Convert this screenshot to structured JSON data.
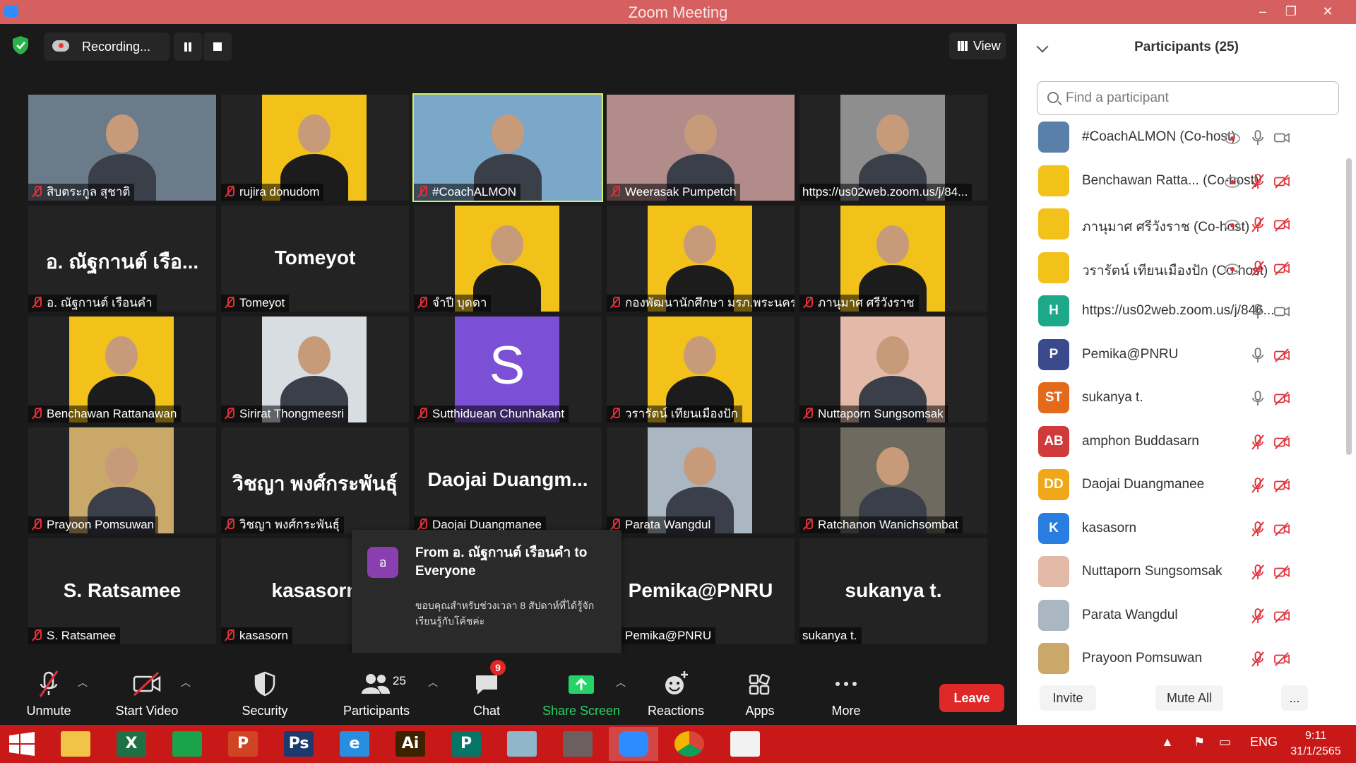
{
  "window": {
    "title": "Zoom Meeting"
  },
  "recording": {
    "label": "Recording..."
  },
  "view_btn": "View",
  "tiles": [
    {
      "name": "สิบตระกูล สุชาติ",
      "big": "",
      "kind": "photo",
      "bg": "#6b7b8a"
    },
    {
      "name": "rujira donudom",
      "big": "",
      "kind": "poster",
      "bg": "#f2c21a"
    },
    {
      "name": "#CoachALMON",
      "big": "",
      "kind": "photo",
      "bg": "#7ba7c9",
      "active": true
    },
    {
      "name": "Weerasak Pumpetch",
      "big": "",
      "kind": "photo",
      "bg": "#b28b8b"
    },
    {
      "name": "https://us02web.zoom.us/j/84...",
      "big": "",
      "kind": "photo",
      "bg": "#8e8e8e",
      "nomute": true
    },
    {
      "name": "อ. ณัฐกานต์ เรือนคำ",
      "big": "อ. ณัฐกานต์  เรือ...",
      "kind": "name"
    },
    {
      "name": "Tomeyot",
      "big": "Tomeyot",
      "kind": "name"
    },
    {
      "name": "จำปี บุดดา",
      "big": "",
      "kind": "poster",
      "bg": "#f2c21a"
    },
    {
      "name": "กองพัฒนานักศึกษา มรภ.พระนคร",
      "big": "",
      "kind": "poster",
      "bg": "#f2c21a"
    },
    {
      "name": "ภานุมาศ ศรีวังราช",
      "big": "",
      "kind": "poster",
      "bg": "#f2c21a"
    },
    {
      "name": "Benchawan Rattanawan",
      "big": "",
      "kind": "poster",
      "bg": "#f2c21a"
    },
    {
      "name": "Sirirat Thongmeesri",
      "big": "",
      "kind": "photo",
      "bg": "#d8dde2"
    },
    {
      "name": "Sutthiduean Chunhakant",
      "big": "",
      "kind": "letter",
      "bg": "#7b4fd6",
      "letter": "S"
    },
    {
      "name": "วรารัตน์ เทียนเมืองปัก",
      "big": "",
      "kind": "poster",
      "bg": "#f2c21a"
    },
    {
      "name": "Nuttaporn Sungsomsak",
      "big": "",
      "kind": "photo",
      "bg": "#e3b9a8"
    },
    {
      "name": "Prayoon Pomsuwan",
      "big": "",
      "kind": "photo",
      "bg": "#c9a86a"
    },
    {
      "name": "วิชญา พงศ์กระพันธุ์",
      "big": "วิชญา พงศ์กระพันธุ์",
      "kind": "name"
    },
    {
      "name": "Daojai Duangmanee",
      "big": "Daojai  Duangm...",
      "kind": "name"
    },
    {
      "name": "Parata Wangdul",
      "big": "",
      "kind": "photo",
      "bg": "#aab6c2"
    },
    {
      "name": "Ratchanon Wanichsombat",
      "big": "",
      "kind": "photo",
      "bg": "#6e6a5f"
    },
    {
      "name": "S. Ratsamee",
      "big": "S. Ratsamee",
      "kind": "name"
    },
    {
      "name": "kasasorn",
      "big": "kasasorn",
      "kind": "name"
    },
    {
      "name": "",
      "big": "",
      "kind": "name"
    },
    {
      "name": "Pemika@PNRU",
      "big": "Pemika@PNRU",
      "kind": "name"
    },
    {
      "name": "sukanya t.",
      "big": "sukanya t.",
      "kind": "name",
      "nomute": true
    }
  ],
  "chat_popup": {
    "avatar": "อ",
    "from": "From อ. ณัฐกานต์  เรือนคำ to Everyone",
    "message": "ขอบคุณสำหรับช่วงเวลา 8 สัปดาห์ที่ได้รู้จักเรียนรู้กับโค้ชค่ะ"
  },
  "toolbar": {
    "unmute": "Unmute",
    "start_video": "Start Video",
    "security": "Security",
    "participants": "Participants",
    "participants_count": "25",
    "chat": "Chat",
    "chat_badge": "9",
    "share_screen": "Share Screen",
    "reactions": "Reactions",
    "apps": "Apps",
    "more": "More",
    "leave": "Leave"
  },
  "panel": {
    "title": "Participants (25)",
    "search_placeholder": "Find a participant",
    "participants": [
      {
        "name": "#CoachALMON (Co-host)",
        "initials": "",
        "color": "#5a7fa8",
        "rec": true,
        "mic": "on",
        "cam": "on"
      },
      {
        "name": "Benchawan Ratta... (Co-host)",
        "initials": "",
        "color": "#f2c21a",
        "rec": true,
        "mic": "off",
        "cam": "off"
      },
      {
        "name": "ภานุมาศ ศรีวังราช (Co-host)",
        "initials": "",
        "color": "#f2c21a",
        "rec": true,
        "mic": "off",
        "cam": "off"
      },
      {
        "name": "วรารัตน์ เทียนเมืองปัก (Co-host)",
        "initials": "",
        "color": "#f2c21a",
        "rec": true,
        "mic": "off",
        "cam": "off"
      },
      {
        "name": "https://us02web.zoom.us/j/846...",
        "initials": "H",
        "color": "#1ea88a",
        "rec": false,
        "mic": "on",
        "cam": "on"
      },
      {
        "name": "Pemika@PNRU",
        "initials": "P",
        "color": "#3a4a8c",
        "rec": false,
        "mic": "on",
        "cam": "off"
      },
      {
        "name": "sukanya t.",
        "initials": "ST",
        "color": "#e26a1a",
        "rec": false,
        "mic": "on",
        "cam": "off"
      },
      {
        "name": "amphon Buddasarn",
        "initials": "AB",
        "color": "#d03a3a",
        "rec": false,
        "mic": "off",
        "cam": "off"
      },
      {
        "name": "Daojai Duangmanee",
        "initials": "DD",
        "color": "#f0a81a",
        "rec": false,
        "mic": "off",
        "cam": "off"
      },
      {
        "name": "kasasorn",
        "initials": "K",
        "color": "#2a7de0",
        "rec": false,
        "mic": "off",
        "cam": "off"
      },
      {
        "name": "Nuttaporn Sungsomsak",
        "initials": "",
        "color": "#e3b9a8",
        "rec": false,
        "mic": "off",
        "cam": "off"
      },
      {
        "name": "Parata Wangdul",
        "initials": "",
        "color": "#aab6c2",
        "rec": false,
        "mic": "off",
        "cam": "off"
      },
      {
        "name": "Prayoon Pomsuwan",
        "initials": "",
        "color": "#c9a86a",
        "rec": false,
        "mic": "off",
        "cam": "off"
      }
    ],
    "invite": "Invite",
    "mute_all": "Mute All",
    "more": "..."
  },
  "taskbar": {
    "lang": "ENG",
    "time": "9:11",
    "date": "31/1/2565",
    "apps": [
      {
        "name": "file-explorer-icon",
        "glyph": "",
        "color": "#f1c447"
      },
      {
        "name": "excel-icon",
        "glyph": "X",
        "color": "#1e7145"
      },
      {
        "name": "store-icon",
        "glyph": "",
        "color": "#1aa34a"
      },
      {
        "name": "powerpoint-icon",
        "glyph": "P",
        "color": "#d04423"
      },
      {
        "name": "photoshop-icon",
        "glyph": "Ps",
        "color": "#1c3a6e"
      },
      {
        "name": "internet-explorer-icon",
        "glyph": "e",
        "color": "#2a8ee0"
      },
      {
        "name": "illustrator-icon",
        "glyph": "Ai",
        "color": "#3d2200"
      },
      {
        "name": "publisher-icon",
        "glyph": "P",
        "color": "#077568"
      },
      {
        "name": "notepad-icon",
        "glyph": "",
        "color": "#8fb6c9"
      },
      {
        "name": "photo-app-icon",
        "glyph": "",
        "color": "#6c5f5f"
      },
      {
        "name": "zoom-icon",
        "glyph": "",
        "color": "#2d8cff"
      },
      {
        "name": "chrome-icon",
        "glyph": "",
        "color": "#e8e8e8"
      },
      {
        "name": "paint-icon",
        "glyph": "",
        "color": "#f2f2f2"
      }
    ]
  }
}
